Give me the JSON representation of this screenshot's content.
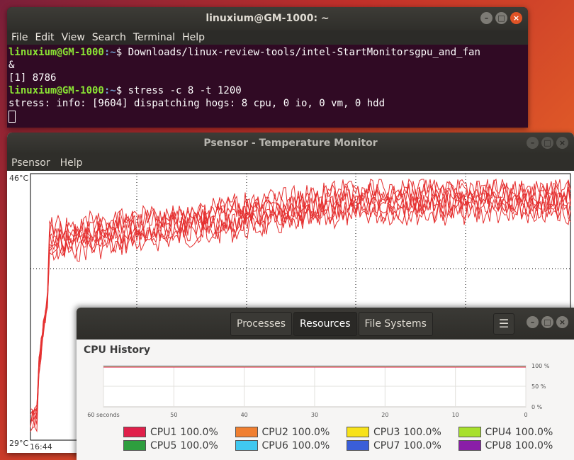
{
  "terminal": {
    "title": "linuxium@GM-1000: ~",
    "menu": [
      "File",
      "Edit",
      "View",
      "Search",
      "Terminal",
      "Help"
    ],
    "lines": [
      {
        "user": "linuxium@GM-1000",
        "path": ":~",
        "cmd": "$ Downloads/linux-review-tools/intel-StartMonitorsgpu_and_fan"
      },
      {
        "text": "&"
      },
      {
        "text": "[1] 8786"
      },
      {
        "user": "linuxium@GM-1000",
        "path": ":~",
        "cmd": "$ stress -c 8 -t 1200"
      },
      {
        "text": "stress: info: [9604] dispatching hogs: 8 cpu, 0 io, 0 vm, 0 hdd"
      }
    ]
  },
  "psensor": {
    "title": "Psensor - Temperature Monitor",
    "menu": [
      "Psensor",
      "Help"
    ],
    "y_max_label": "46°C",
    "y_min_label": "29°C",
    "x_start_label": "16:44",
    "line_color": "#e53030"
  },
  "sysmon": {
    "tabs": [
      "Processes",
      "Resources",
      "File Systems"
    ],
    "active_tab": "Resources",
    "menu_icon": "hamburger-icon",
    "section_title": "CPU History",
    "x_labels": [
      "60 seconds",
      "50",
      "40",
      "30",
      "20",
      "10",
      "0"
    ],
    "y_labels": [
      "100 %",
      "50 %",
      "0 %"
    ],
    "cpus": [
      {
        "name": "CPU1",
        "value": "100.0%",
        "color": "#e0204a"
      },
      {
        "name": "CPU2",
        "value": "100.0%",
        "color": "#f07f30"
      },
      {
        "name": "CPU3",
        "value": "100.0%",
        "color": "#f7e21a"
      },
      {
        "name": "CPU4",
        "value": "100.0%",
        "color": "#a8e02c"
      },
      {
        "name": "CPU5",
        "value": "100.0%",
        "color": "#2e9e3e"
      },
      {
        "name": "CPU6",
        "value": "100.0%",
        "color": "#40c8f0"
      },
      {
        "name": "CPU7",
        "value": "100.0%",
        "color": "#3a5ed8"
      },
      {
        "name": "CPU8",
        "value": "100.0%",
        "color": "#8a1ea8"
      }
    ]
  }
}
